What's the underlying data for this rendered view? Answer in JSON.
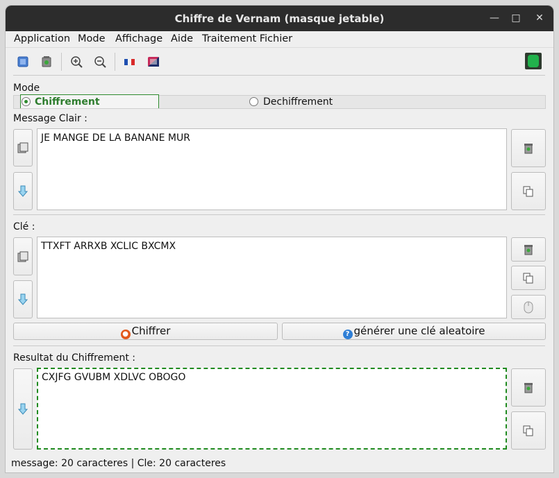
{
  "window": {
    "title": "Chiffre de Vernam (masque jetable)"
  },
  "menu": [
    "Application",
    "Mode",
    "Affichage",
    "Aide",
    "Traitement Fichier"
  ],
  "toolbar": {
    "icons": [
      "select-all-icon",
      "clear-icon",
      "zoom-in-icon",
      "zoom-out-icon",
      "french-flag-icon",
      "english-flag-icon",
      "app-logo-icon"
    ]
  },
  "mode": {
    "label": "Mode",
    "option_encrypt": "Chiffrement",
    "option_decrypt": "Dechiffrement",
    "selected": "Chiffrement"
  },
  "message": {
    "label": "Message Clair :",
    "value": "JE MANGE DE LA BANANE MUR"
  },
  "key": {
    "label": "Clé :",
    "value": "TTXFT ARRXB XCLIC BXCMX"
  },
  "actions": {
    "encrypt_label": "Chiffrer",
    "generate_label": "générer une clé aleatoire"
  },
  "result": {
    "label": "Resultat du Chiffrement :",
    "value": "CXJFG GVUBM XDLVC OBOGO"
  },
  "status": {
    "text": "message: 20 caracteres | Cle: 20 caracteres"
  },
  "colors": {
    "accent": "#2e8b2e",
    "titlebar": "#2c2c2c",
    "lock": "#e2591c",
    "help": "#2f7fd6"
  }
}
